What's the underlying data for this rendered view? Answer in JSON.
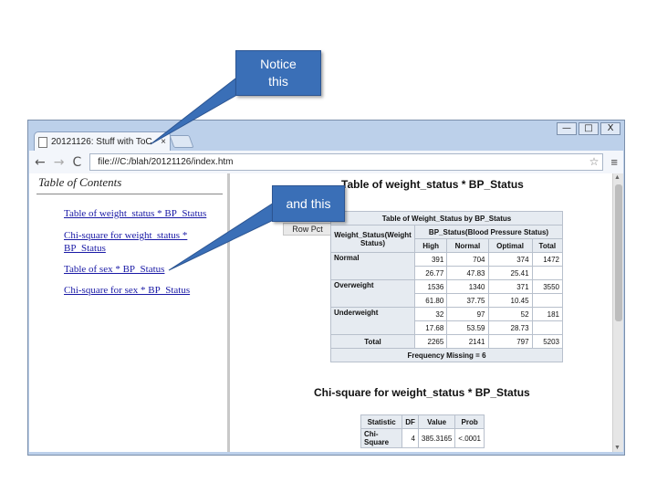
{
  "callouts": {
    "top": "Notice\nthis",
    "middle": "and this"
  },
  "window": {
    "controls": [
      "—",
      "□",
      "X"
    ]
  },
  "tab": {
    "title": "20121126: Stuff with ToC",
    "close": "×"
  },
  "toolbar": {
    "back": "←",
    "forward": "→",
    "reload": "C",
    "url": "file:///C:/blah/20121126/index.htm",
    "menu": "≡"
  },
  "toc": {
    "title": "Table of Contents",
    "links": [
      "Table of weight_status * BP_Status",
      "Chi-square for weight_status * BP_Status",
      "Table of sex * BP_Status",
      "Chi-square for sex * BP_Status"
    ]
  },
  "content": {
    "heading1": "Table of weight_status * BP_Status",
    "heading2": "Chi-square for weight_status * BP_Status",
    "row_pct_button": "Row Pct"
  },
  "freq_table": {
    "caption": "Table of Weight_Status by BP_Status",
    "row_var_header": "Weight_Status(Weight Status)",
    "col_var_header": "BP_Status(Blood Pressure Status)",
    "columns": [
      "High",
      "Normal",
      "Optimal",
      "Total"
    ],
    "rows": [
      {
        "label": "Normal",
        "counts": [
          "391",
          "704",
          "374",
          "1472"
        ],
        "pcts": [
          "26.77",
          "47.83",
          "25.41",
          ""
        ]
      },
      {
        "label": "Overweight",
        "counts": [
          "1536",
          "1340",
          "371",
          "3550"
        ],
        "pcts": [
          "61.80",
          "37.75",
          "10.45",
          ""
        ]
      },
      {
        "label": "Underweight",
        "counts": [
          "32",
          "97",
          "52",
          "181"
        ],
        "pcts": [
          "17.68",
          "53.59",
          "28.73",
          ""
        ]
      }
    ],
    "total_label": "Total",
    "totals": [
      "2265",
      "2141",
      "797",
      "5203"
    ],
    "footer": "Frequency Missing = 6"
  },
  "chi_table": {
    "headers": [
      "Statistic",
      "DF",
      "Value",
      "Prob"
    ],
    "row": [
      "Chi-Square",
      "4",
      "385.3165",
      "<.0001"
    ]
  }
}
